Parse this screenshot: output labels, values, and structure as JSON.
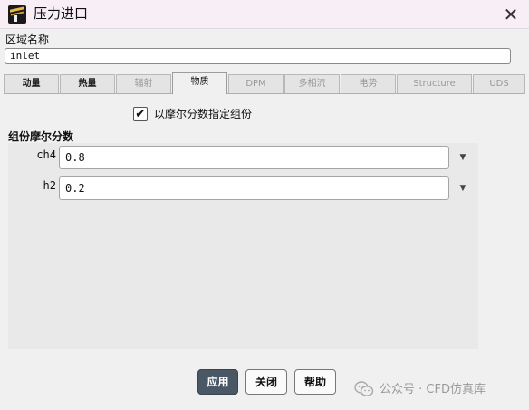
{
  "window": {
    "title": "压力进口",
    "close_glyph": "✕"
  },
  "zone": {
    "label": "区域名称",
    "value": "inlet"
  },
  "tabs": [
    {
      "label": "动量",
      "state": "enabled"
    },
    {
      "label": "热量",
      "state": "enabled"
    },
    {
      "label": "辐射",
      "state": "disabled"
    },
    {
      "label": "物质",
      "state": "active"
    },
    {
      "label": "DPM",
      "state": "disabled"
    },
    {
      "label": "多相流",
      "state": "disabled"
    },
    {
      "label": "电势",
      "state": "disabled"
    },
    {
      "label": "Structure",
      "state": "disabled"
    },
    {
      "label": "UDS",
      "state": "disabled"
    }
  ],
  "options": {
    "mole_fraction_checkbox": {
      "label": "以摩尔分数指定组份",
      "checked": true,
      "glyph": "✔"
    }
  },
  "species_group": {
    "title": "组份摩尔分数",
    "rows": [
      {
        "name": "ch4",
        "value": "0.8",
        "dropdown_glyph": "▼"
      },
      {
        "name": "h2",
        "value": "0.2",
        "dropdown_glyph": "▼"
      }
    ]
  },
  "buttons": {
    "apply": "应用",
    "close": "关闭",
    "help": "帮助"
  },
  "watermark": {
    "text": "公众号 · CFD仿真库"
  },
  "colors": {
    "titlebar": "#f7eef6",
    "primary_button": "#4a5866",
    "panel": "#e9e9e9"
  },
  "icons": {
    "app": "fluent-app-icon",
    "close": "close-icon",
    "dropdown": "chevron-down-icon",
    "check": "check-icon",
    "watermark": "wechat-icon"
  }
}
